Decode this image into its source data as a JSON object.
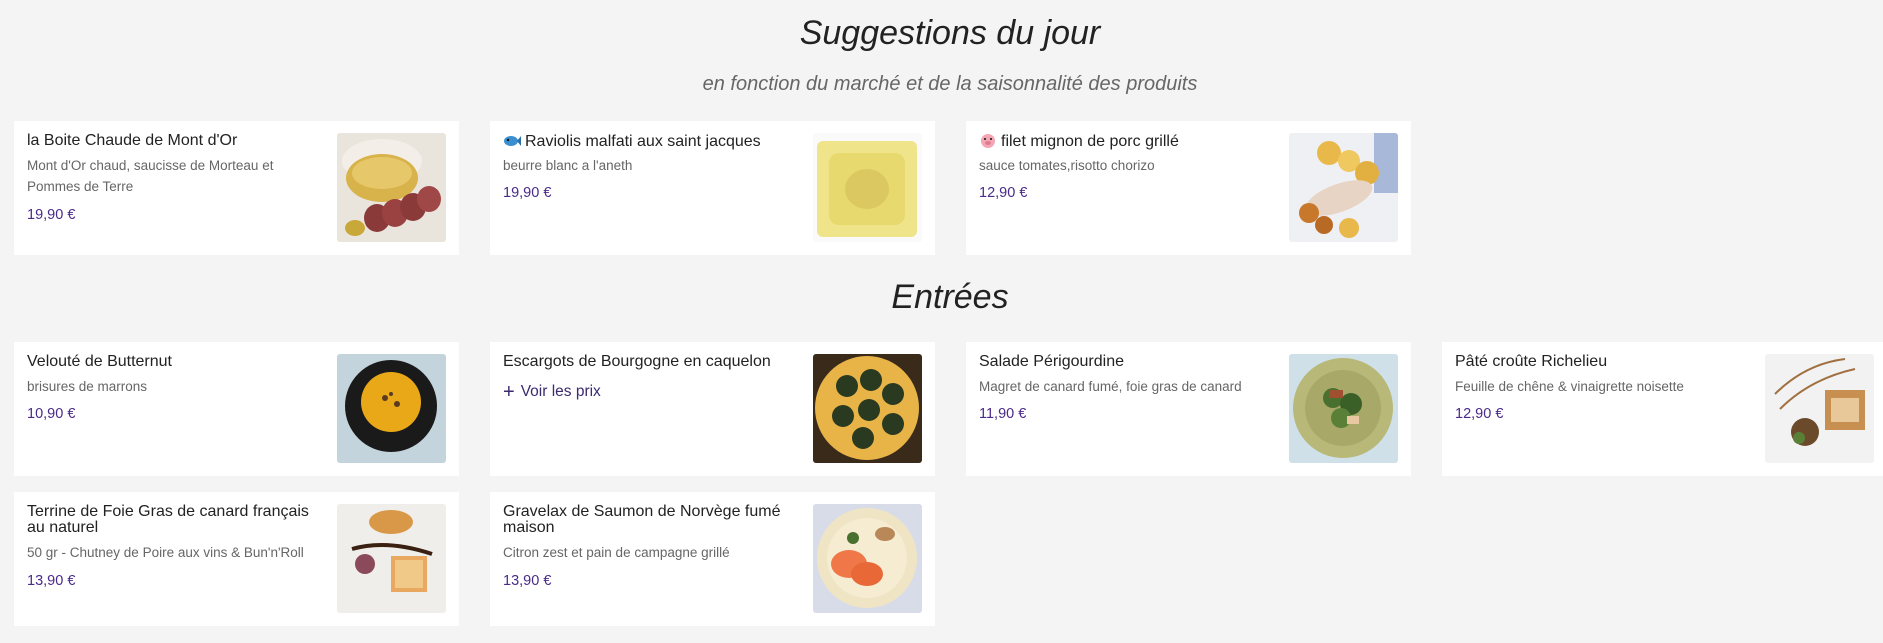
{
  "suggestions": {
    "title": "Suggestions du jour",
    "subtitle": "en fonction du marché et de la saisonnalité des produits",
    "items": [
      {
        "name": "la Boite Chaude de Mont d'Or",
        "desc": "Mont d'Or chaud, saucisse de Morteau et Pommes de Terre",
        "price": "19,90 €"
      },
      {
        "name": "Raviolis malfati aux saint jacques",
        "desc": "beurre blanc a l'aneth",
        "price": "19,90 €",
        "icon": "fish-icon"
      },
      {
        "name": "filet mignon de porc grillé",
        "desc": "sauce tomates,risotto chorizo",
        "price": "12,90 €",
        "icon": "pig-icon"
      }
    ]
  },
  "entrees": {
    "title": "Entrées",
    "items": [
      {
        "name": "Velouté de Butternut",
        "desc": "brisures de marrons",
        "price": "10,90 €"
      },
      {
        "name": "Escargots de Bourgogne en caquelon",
        "voir": "Voir les prix"
      },
      {
        "name": "Salade Périgourdine",
        "desc": "Magret de canard fumé, foie gras de canard",
        "price": "11,90 €"
      },
      {
        "name": "Pâté croûte Richelieu",
        "desc": "Feuille de chêne & vinaigrette noisette",
        "price": "12,90 €"
      },
      {
        "name": "Terrine de Foie Gras de canard français au naturel",
        "desc": "50 gr - Chutney de Poire aux vins & Bun'n'Roll",
        "price": "13,90 €"
      },
      {
        "name": "Gravelax de Saumon de Norvège fumé maison",
        "desc": "Citron zest et pain de campagne grillé",
        "price": "13,90 €"
      }
    ]
  },
  "colors": {
    "background": "#f4f4f4",
    "card": "#ffffff",
    "price": "#4a2a8a"
  }
}
